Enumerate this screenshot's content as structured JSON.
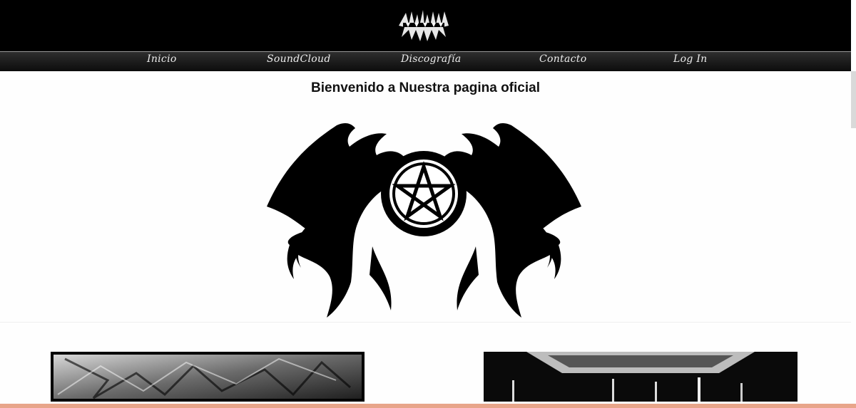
{
  "nav": {
    "items": [
      {
        "label": "Inicio"
      },
      {
        "label": "SoundCloud"
      },
      {
        "label": "Discografía"
      },
      {
        "label": "Contacto"
      },
      {
        "label": "Log In"
      }
    ]
  },
  "main": {
    "welcome": "Bienvenido a Nuestra pagina oficial"
  },
  "colors": {
    "header_bg": "#000000",
    "nav_text": "#ececec",
    "bottom_accent": "#e8a58a"
  }
}
